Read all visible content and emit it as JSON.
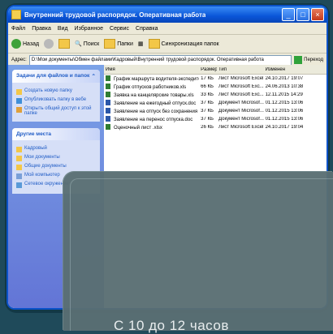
{
  "window": {
    "title": "Внутренний трудовой распорядок. Оперативная работа",
    "min": "_",
    "max": "□",
    "close": "×"
  },
  "menu": [
    "Файл",
    "Правка",
    "Вид",
    "Избранное",
    "Сервис",
    "Справка"
  ],
  "toolbar": {
    "back": "Назад",
    "search": "Поиск",
    "folders": "Папки",
    "sync": "Синхронизация папок"
  },
  "address": {
    "label": "Адрес:",
    "path": "D:\\Мои документы\\Обмен файлами\\Кадровый\\Внутренний трудовой распорядок. Оперативная работа",
    "go": "Переход"
  },
  "sidebar": {
    "tasks": {
      "title": "Задачи для файлов и папок",
      "items": [
        "Создать новую папку",
        "Опубликовать папку в вебе",
        "Открыть общий доступ к этой папке"
      ]
    },
    "places": {
      "title": "Другие места",
      "items": [
        "Кадровый",
        "Мои документы",
        "Общие документы",
        "Мой компьютер",
        "Сетевое окружение"
      ]
    }
  },
  "files": {
    "headers": [
      "Имя",
      "Размер",
      "Тип",
      "Изменен"
    ],
    "rows": [
      {
        "name": "График маршрута водителя-экспедитор...",
        "size": "17 КБ",
        "type": "Лист Microsoft Excel",
        "date": "24.10.2017 19:07",
        "kind": "xls"
      },
      {
        "name": "График отпусков работников.xls",
        "size": "66 КБ",
        "type": "Лист Microsoft Exc...",
        "date": "24.06.2013 10:38",
        "kind": "xls"
      },
      {
        "name": "Заявка на канцелярские товары.xls",
        "size": "33 КБ",
        "type": "Лист Microsoft Exc...",
        "date": "12.11.2015 14:29",
        "kind": "xls"
      },
      {
        "name": "Заявление на ежегодный отпуск.doc",
        "size": "37 КБ",
        "type": "Документ Microsof...",
        "date": "01.12.2015 13:06",
        "kind": "doc"
      },
      {
        "name": "Заявление на отпуск без сохранения за...",
        "size": "37 КБ",
        "type": "Документ Microsof...",
        "date": "01.12.2015 13:06",
        "kind": "doc"
      },
      {
        "name": "Заявление на перенос отпуска.doc",
        "size": "37 КБ",
        "type": "Документ Microsof...",
        "date": "01.12.2015 13:06",
        "kind": "doc"
      },
      {
        "name": "Оценочный лист .xlsx",
        "size": "26 КБ",
        "type": "Лист Microsoft Excel",
        "date": "24.10.2017 19:04",
        "kind": "xls"
      }
    ]
  },
  "caption": "С 10 до 12 часов"
}
